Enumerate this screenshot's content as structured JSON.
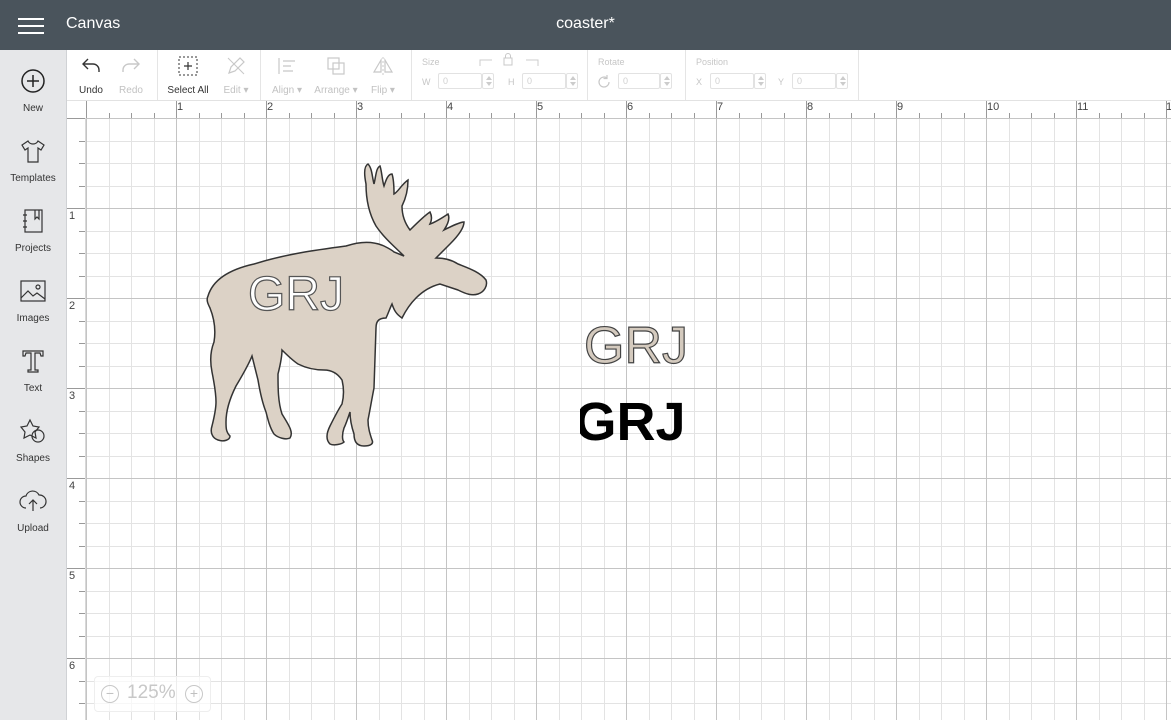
{
  "header": {
    "menu_icon": "hamburger-icon",
    "app_title": "Canvas",
    "doc_title": "coaster*"
  },
  "sidebar": {
    "items": [
      {
        "label": "New",
        "icon": "plus-circle-icon"
      },
      {
        "label": "Templates",
        "icon": "tshirt-icon"
      },
      {
        "label": "Projects",
        "icon": "notebook-icon"
      },
      {
        "label": "Images",
        "icon": "image-icon"
      },
      {
        "label": "Text",
        "icon": "text-t-icon"
      },
      {
        "label": "Shapes",
        "icon": "shapes-icon"
      },
      {
        "label": "Upload",
        "icon": "cloud-upload-icon"
      }
    ]
  },
  "toolbar": {
    "undo": "Undo",
    "redo": "Redo",
    "select_all": "Select All",
    "edit": "Edit",
    "align": "Align",
    "arrange": "Arrange",
    "flip": "Flip",
    "size": {
      "title": "Size",
      "w_label": "W",
      "h_label": "H",
      "w_value": "0",
      "h_value": "0"
    },
    "rotate": {
      "title": "Rotate",
      "value": "0"
    },
    "position": {
      "title": "Position",
      "x_label": "X",
      "y_label": "Y",
      "x_value": "0",
      "y_value": "0"
    }
  },
  "ruler": {
    "top": [
      "1",
      "2",
      "3",
      "4",
      "5",
      "6",
      "7",
      "8",
      "9",
      "10",
      "11",
      "1"
    ],
    "left": [
      "1",
      "2",
      "3",
      "4",
      "5",
      "6"
    ]
  },
  "canvas": {
    "moose_text": "GRJ",
    "outline_text": "GRJ",
    "solid_text": "GRJ",
    "moose_fill": "#dcd2c6",
    "outline_fill": "#d4cabe",
    "solid_fill": "#000000"
  },
  "zoom": {
    "value": "125%",
    "minus": "−",
    "plus": "+"
  }
}
